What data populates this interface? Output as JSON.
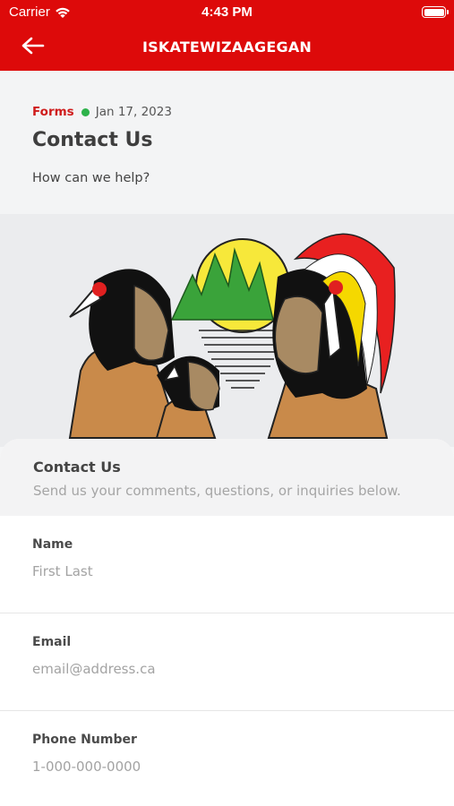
{
  "status_bar": {
    "carrier": "Carrier",
    "time": "4:43 PM"
  },
  "header": {
    "title": "ISKATEWIZAAGEGAN",
    "back_icon": "arrow-left-icon",
    "background": "#dd0a0a"
  },
  "article": {
    "category": "Forms",
    "date": "Jan 17, 2023",
    "title": "Contact Us",
    "subtitle": "How can we help?"
  },
  "form": {
    "title": "Contact Us",
    "description": "Send us your comments, questions, or inquiries below.",
    "fields": [
      {
        "label": "Name",
        "placeholder": "First Last"
      },
      {
        "label": "Email",
        "placeholder": "email@address.ca"
      },
      {
        "label": "Phone Number",
        "placeholder": "1-000-000-0000"
      }
    ]
  }
}
